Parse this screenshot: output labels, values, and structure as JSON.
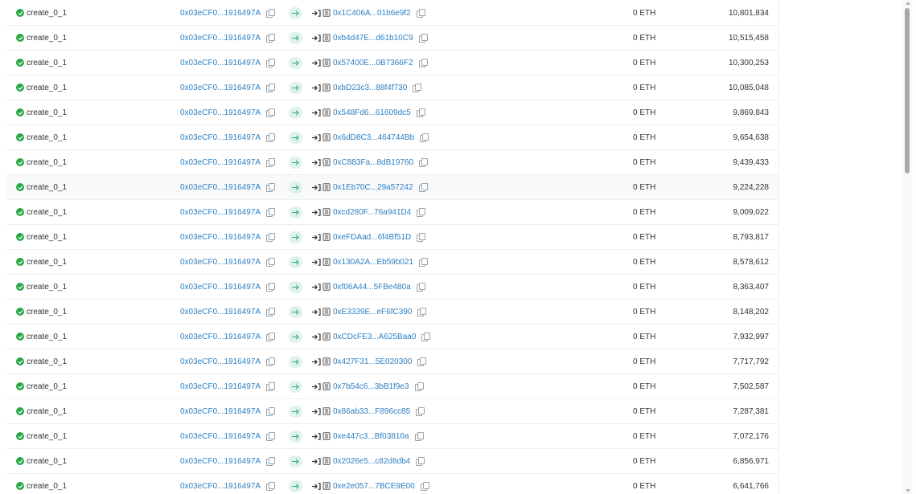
{
  "transactions": [
    {
      "method": "create_0_1",
      "from": "0x03eCF0...1916497A",
      "to": "0x1C406A...01b6e9f2",
      "value": "0 ETH",
      "block": "10,801,834"
    },
    {
      "method": "create_0_1",
      "from": "0x03eCF0...1916497A",
      "to": "0xb4d47E...d61b10C9",
      "value": "0 ETH",
      "block": "10,515,458"
    },
    {
      "method": "create_0_1",
      "from": "0x03eCF0...1916497A",
      "to": "0x57400E...0B7366F2",
      "value": "0 ETH",
      "block": "10,300,253"
    },
    {
      "method": "create_0_1",
      "from": "0x03eCF0...1916497A",
      "to": "0xbD23c3...88f4f730",
      "value": "0 ETH",
      "block": "10,085,048"
    },
    {
      "method": "create_0_1",
      "from": "0x03eCF0...1916497A",
      "to": "0x548Fd6...61609dc5",
      "value": "0 ETH",
      "block": "9,869,843"
    },
    {
      "method": "create_0_1",
      "from": "0x03eCF0...1916497A",
      "to": "0x6dD8C3...464744Bb",
      "value": "0 ETH",
      "block": "9,654,638"
    },
    {
      "method": "create_0_1",
      "from": "0x03eCF0...1916497A",
      "to": "0xC883Fa...8dB19760",
      "value": "0 ETH",
      "block": "9,439,433"
    },
    {
      "method": "create_0_1",
      "from": "0x03eCF0...1916497A",
      "to": "0x1Eb70C...29a57242",
      "value": "0 ETH",
      "block": "9,224,228"
    },
    {
      "method": "create_0_1",
      "from": "0x03eCF0...1916497A",
      "to": "0xcd280F...76a941D4",
      "value": "0 ETH",
      "block": "9,009,022"
    },
    {
      "method": "create_0_1",
      "from": "0x03eCF0...1916497A",
      "to": "0xeFDAad...6f4Bf51D",
      "value": "0 ETH",
      "block": "8,793,817"
    },
    {
      "method": "create_0_1",
      "from": "0x03eCF0...1916497A",
      "to": "0x130A2A...Eb59b021",
      "value": "0 ETH",
      "block": "8,578,612"
    },
    {
      "method": "create_0_1",
      "from": "0x03eCF0...1916497A",
      "to": "0xf06A44...5FBe480a",
      "value": "0 ETH",
      "block": "8,363,407"
    },
    {
      "method": "create_0_1",
      "from": "0x03eCF0...1916497A",
      "to": "0xE3339E...eF6fC390",
      "value": "0 ETH",
      "block": "8,148,202"
    },
    {
      "method": "create_0_1",
      "from": "0x03eCF0...1916497A",
      "to": "0xCDcFE3...A625Baa0",
      "value": "0 ETH",
      "block": "7,932,997"
    },
    {
      "method": "create_0_1",
      "from": "0x03eCF0...1916497A",
      "to": "0x427F31...5E020300",
      "value": "0 ETH",
      "block": "7,717,792"
    },
    {
      "method": "create_0_1",
      "from": "0x03eCF0...1916497A",
      "to": "0x7b54c6...3bB1f9e3",
      "value": "0 ETH",
      "block": "7,502,587"
    },
    {
      "method": "create_0_1",
      "from": "0x03eCF0...1916497A",
      "to": "0x86ab33...F896cc85",
      "value": "0 ETH",
      "block": "7,287,381"
    },
    {
      "method": "create_0_1",
      "from": "0x03eCF0...1916497A",
      "to": "0xe447c3...Bf03810a",
      "value": "0 ETH",
      "block": "7,072,176"
    },
    {
      "method": "create_0_1",
      "from": "0x03eCF0...1916497A",
      "to": "0x2026e5...c82d8db4",
      "value": "0 ETH",
      "block": "6,856,971"
    },
    {
      "method": "create_0_1",
      "from": "0x03eCF0...1916497A",
      "to": "0xe2e057...7BCE9E00",
      "value": "0 ETH",
      "block": "6,641,766"
    }
  ],
  "highlighted_row": 7,
  "icons": {
    "status": "check-circle-icon",
    "copy": "copy-icon",
    "direction": "arrow-right-icon",
    "contract_call": "enter-icon",
    "contract": "contract-icon"
  },
  "colors": {
    "link": "#2e7fc1",
    "success": "#28a745",
    "arrow_bg": "#dff3ea",
    "arrow_fg": "#3aa776"
  }
}
